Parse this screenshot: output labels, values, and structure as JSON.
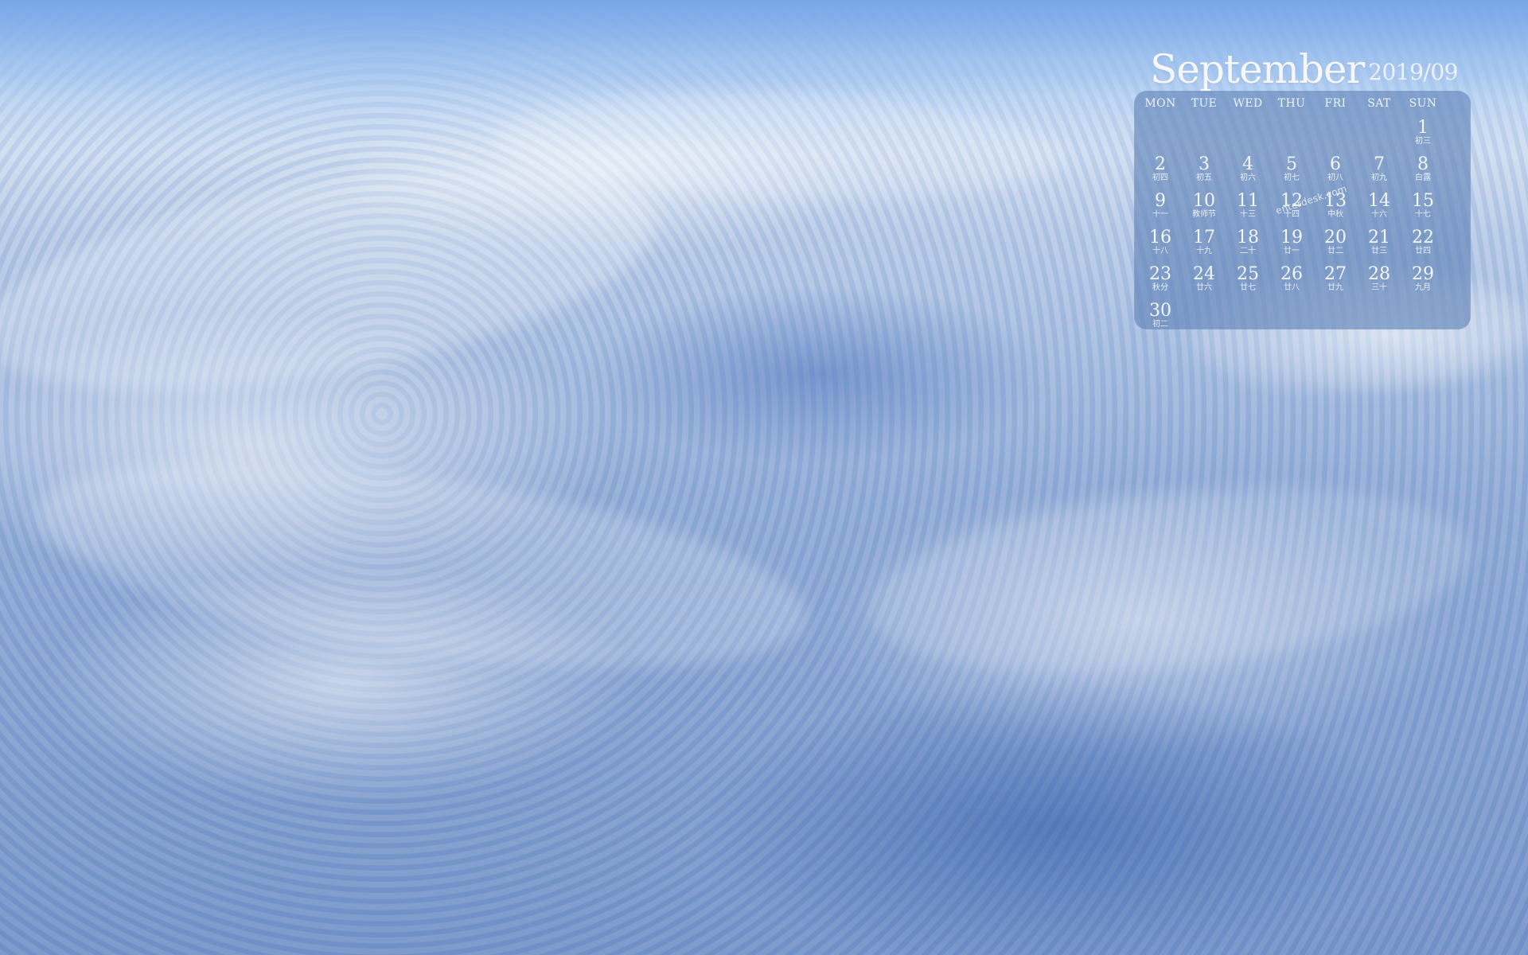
{
  "calendar": {
    "month": "September",
    "year_month": "2019/09",
    "weekdays": [
      "MON",
      "TUE",
      "WED",
      "THU",
      "FRI",
      "SAT",
      "SUN"
    ],
    "watermark": "enterdesk.com",
    "days": [
      {
        "num": "1",
        "sub": "初三"
      },
      {
        "num": "2",
        "sub": "初四"
      },
      {
        "num": "3",
        "sub": "初五"
      },
      {
        "num": "4",
        "sub": "初六"
      },
      {
        "num": "5",
        "sub": "初七"
      },
      {
        "num": "6",
        "sub": "初八"
      },
      {
        "num": "7",
        "sub": "初九"
      },
      {
        "num": "8",
        "sub": "白露"
      },
      {
        "num": "9",
        "sub": "十一"
      },
      {
        "num": "10",
        "sub": "教师节"
      },
      {
        "num": "11",
        "sub": "十三"
      },
      {
        "num": "12",
        "sub": "十四"
      },
      {
        "num": "13",
        "sub": "中秋"
      },
      {
        "num": "14",
        "sub": "十六"
      },
      {
        "num": "15",
        "sub": "十七"
      },
      {
        "num": "16",
        "sub": "十八"
      },
      {
        "num": "17",
        "sub": "十九"
      },
      {
        "num": "18",
        "sub": "二十"
      },
      {
        "num": "19",
        "sub": "廿一"
      },
      {
        "num": "20",
        "sub": "廿二"
      },
      {
        "num": "21",
        "sub": "廿三"
      },
      {
        "num": "22",
        "sub": "廿四"
      },
      {
        "num": "23",
        "sub": "秋分"
      },
      {
        "num": "24",
        "sub": "廿六"
      },
      {
        "num": "25",
        "sub": "廿七"
      },
      {
        "num": "26",
        "sub": "廿八"
      },
      {
        "num": "27",
        "sub": "廿九"
      },
      {
        "num": "28",
        "sub": "三十"
      },
      {
        "num": "29",
        "sub": "九月"
      },
      {
        "num": "30",
        "sub": "初二"
      }
    ]
  }
}
